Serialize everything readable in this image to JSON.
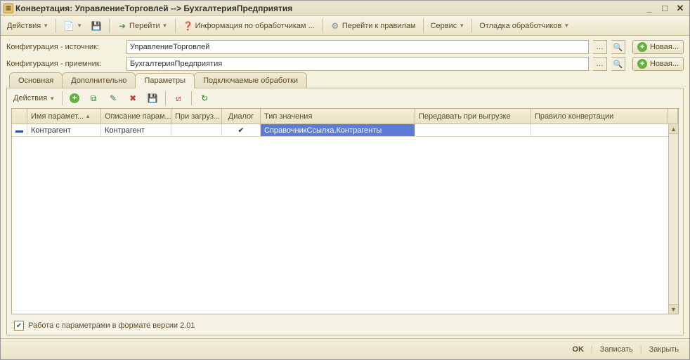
{
  "window": {
    "title": "Конвертация: УправлениеТорговлей --> БухгалтерияПредприятия"
  },
  "toolbar": {
    "actions": "Действия",
    "go": "Перейти",
    "info": "Информация по обработчикам ...",
    "rules": "Перейти к правилам",
    "service": "Сервис",
    "debug": "Отладка обработчиков"
  },
  "form": {
    "source_label": "Конфигурация - источник:",
    "source_value": "УправлениеТорговлей",
    "dest_label": "Конфигурация - приемник:",
    "dest_value": "БухгалтерияПредприятия",
    "new_label": "Новая..."
  },
  "tabs": {
    "t1": "Основная",
    "t2": "Дополнительно",
    "t3": "Параметры",
    "t4": "Подключаемые обработки"
  },
  "grid_toolbar": {
    "actions": "Действия"
  },
  "grid_head": {
    "c1": "Имя парамет...",
    "c2": "Описание парам...",
    "c3": "При загруз...",
    "c4": "Диалог",
    "c5": "Тип значения",
    "c6": "Передавать при выгрузке",
    "c7": "Правило конвертации"
  },
  "grid_rows": [
    {
      "name": "Контрагент",
      "desc": "Контрагент",
      "onload": "",
      "dialog": "✔",
      "type": "СправочникСсылка.Контрагенты",
      "transfer": "",
      "rule": ""
    }
  ],
  "checkbox": {
    "label": "Работа с параметрами в формате версии 2.01",
    "checked": true
  },
  "statusbar": {
    "ok": "OK",
    "save": "Записать",
    "close": "Закрыть"
  }
}
